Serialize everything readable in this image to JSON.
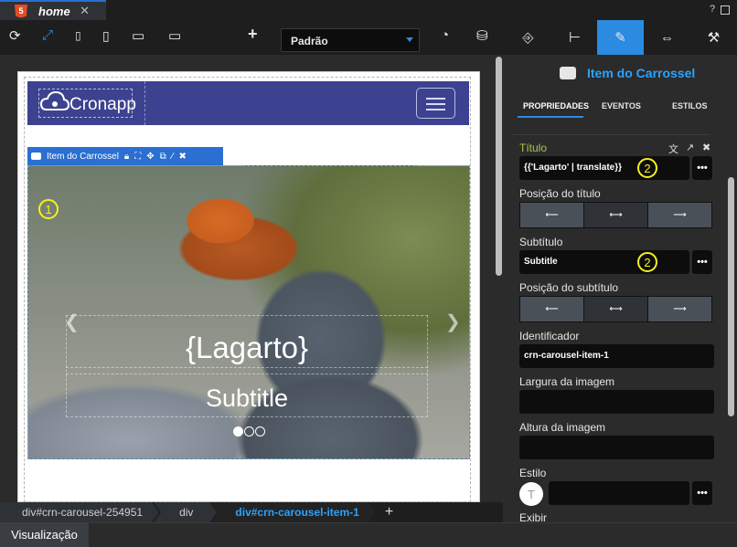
{
  "tabs": [
    {
      "label": "home",
      "badge": "5"
    }
  ],
  "toolbar": {
    "device_select": "Padrão"
  },
  "navbar": {
    "brand": "Cronapp"
  },
  "selection": {
    "label": "Item do Carrossel"
  },
  "carousel": {
    "marker": "1",
    "title": "{Lagarto}",
    "subtitle": "Subtitle",
    "indicators": 3,
    "active_indicator": 1
  },
  "breadcrumb": {
    "items": [
      "div#crn-carousel-254951",
      "div",
      "div#crn-carousel-item-1"
    ],
    "add_label": "+"
  },
  "bottom": {
    "tab_label": "Visualização"
  },
  "panel": {
    "title": "Item do Carrossel",
    "tabs": [
      "PROPRIEDADES",
      "EVENTOS",
      "ESTILOS"
    ],
    "fields": {
      "titulo_label": "Título",
      "titulo_value": "{{'Lagarto' | translate}}",
      "titulo_pos_label": "Posição do título",
      "subtitulo_label": "Subtítulo",
      "subtitulo_value": "Subtitle",
      "subtitulo_pos_label": "Posição do subtítulo",
      "identificador_label": "Identificador",
      "identificador_value": "crn-carousel-item-1",
      "largura_label": "Largura da imagem",
      "altura_label": "Altura da imagem",
      "estilo_label": "Estilo",
      "estilo_avatar": "T",
      "exibir_label": "Exibir"
    },
    "markers": [
      "2",
      "2"
    ],
    "dots_label": "•••"
  },
  "colors": {
    "accent": "#2a8be0",
    "navbar": "#3c4290",
    "title_label": "#a8c84a",
    "marker": "#f6f01a"
  }
}
